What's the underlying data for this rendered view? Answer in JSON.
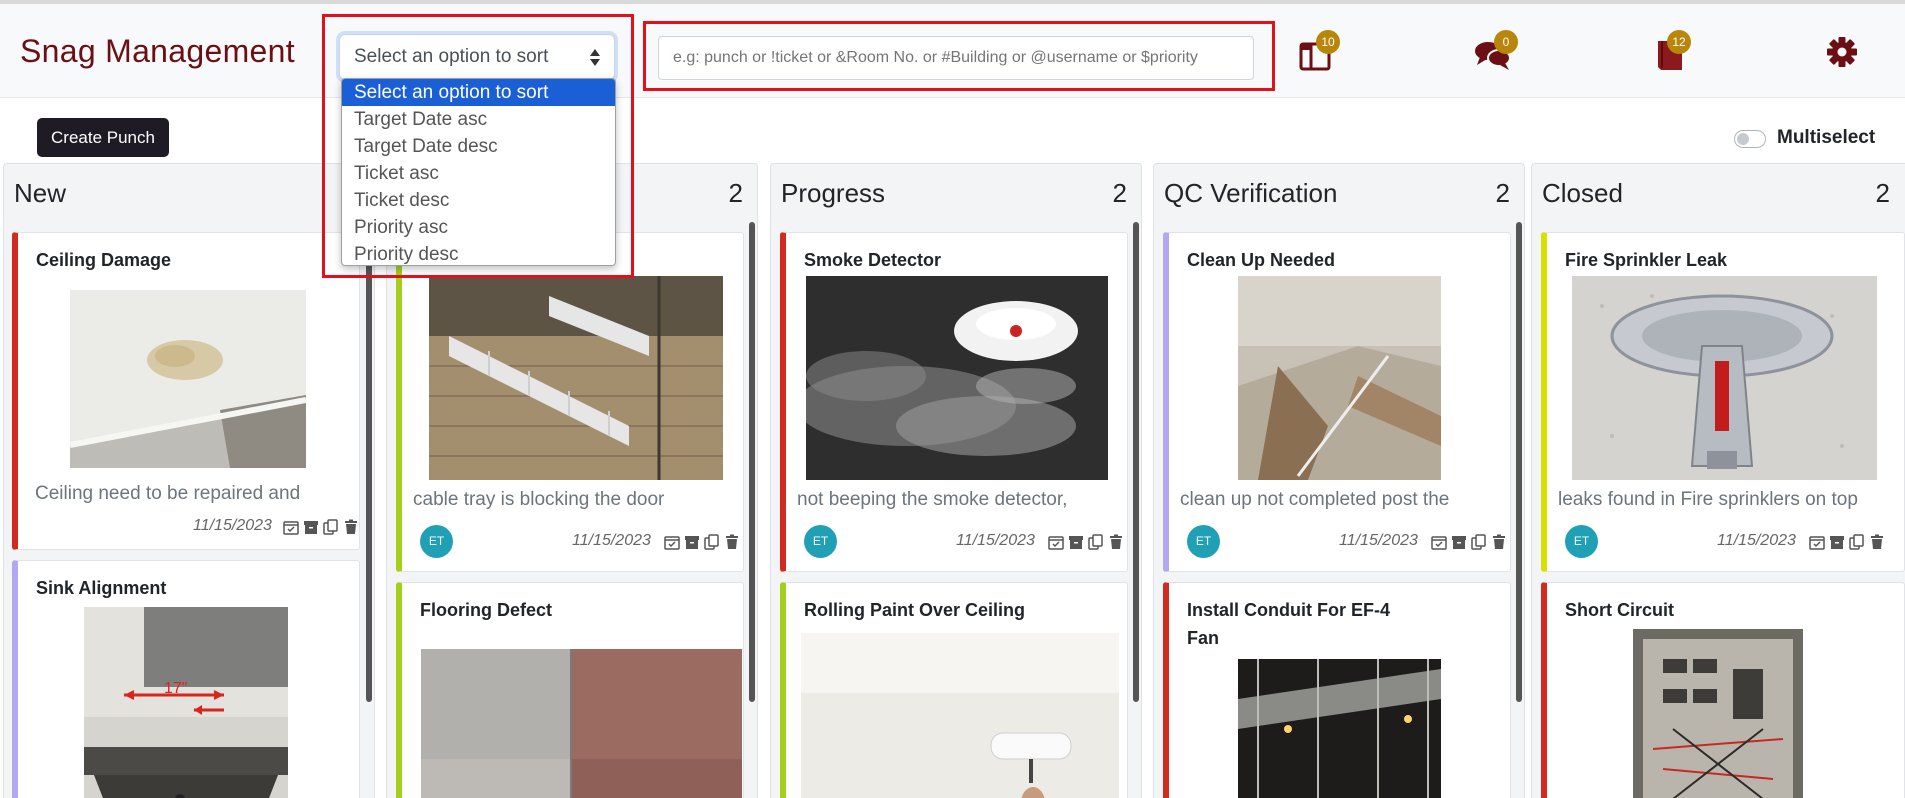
{
  "app": {
    "title": "Snag Management"
  },
  "sort": {
    "selected": "Select an option to sort",
    "options": [
      "Select an option to sort",
      "Target Date asc",
      "Target Date desc",
      "Ticket asc",
      "Ticket desc",
      "Priority asc",
      "Priority desc"
    ]
  },
  "search": {
    "placeholder": "e.g: punch or !ticket or &Room No. or #Building or @username or $priority"
  },
  "badges": {
    "boards": "10",
    "messages": "0",
    "reports": "12"
  },
  "toolbar": {
    "create_label": "Create Punch",
    "multiselect_label": "Multiselect"
  },
  "colors": {
    "brand": "#6b0f14",
    "badge": "#b8860b",
    "red": "#d22a1e",
    "lime": "#a6ce1c",
    "lavender": "#b3a7f2",
    "yellow": "#d8e000",
    "avatar": "#1fa0b4"
  },
  "columns": [
    {
      "title": "New",
      "count": "",
      "cards": [
        {
          "title": "Ceiling Damage",
          "desc": "Ceiling need to be repaired and",
          "date": "11/15/2023",
          "avatar": ""
        },
        {
          "title": "Sink Alignment",
          "dimension_note": "17\""
        }
      ]
    },
    {
      "title": "",
      "count": "2",
      "cards": [
        {
          "title": "",
          "desc": "cable tray is blocking the door",
          "date": "11/15/2023",
          "avatar": "ET"
        },
        {
          "title": "Flooring Defect"
        }
      ]
    },
    {
      "title": "Progress",
      "count": "2",
      "cards": [
        {
          "title": "Smoke Detector",
          "desc": "not beeping the smoke detector,",
          "date": "11/15/2023",
          "avatar": "ET"
        },
        {
          "title": "Rolling Paint Over Ceiling"
        }
      ]
    },
    {
      "title": "QC Verification",
      "count": "2",
      "cards": [
        {
          "title": "Clean Up Needed",
          "desc": "clean up not completed post the",
          "date": "11/15/2023",
          "avatar": "ET"
        },
        {
          "title": "Install Conduit For EF-4 Fan"
        }
      ]
    },
    {
      "title": "Closed",
      "count": "2",
      "cards": [
        {
          "title": "Fire Sprinkler Leak",
          "desc": "leaks found in Fire sprinklers on top",
          "date": "11/15/2023",
          "avatar": "ET"
        },
        {
          "title": "Short Circuit"
        }
      ]
    }
  ]
}
